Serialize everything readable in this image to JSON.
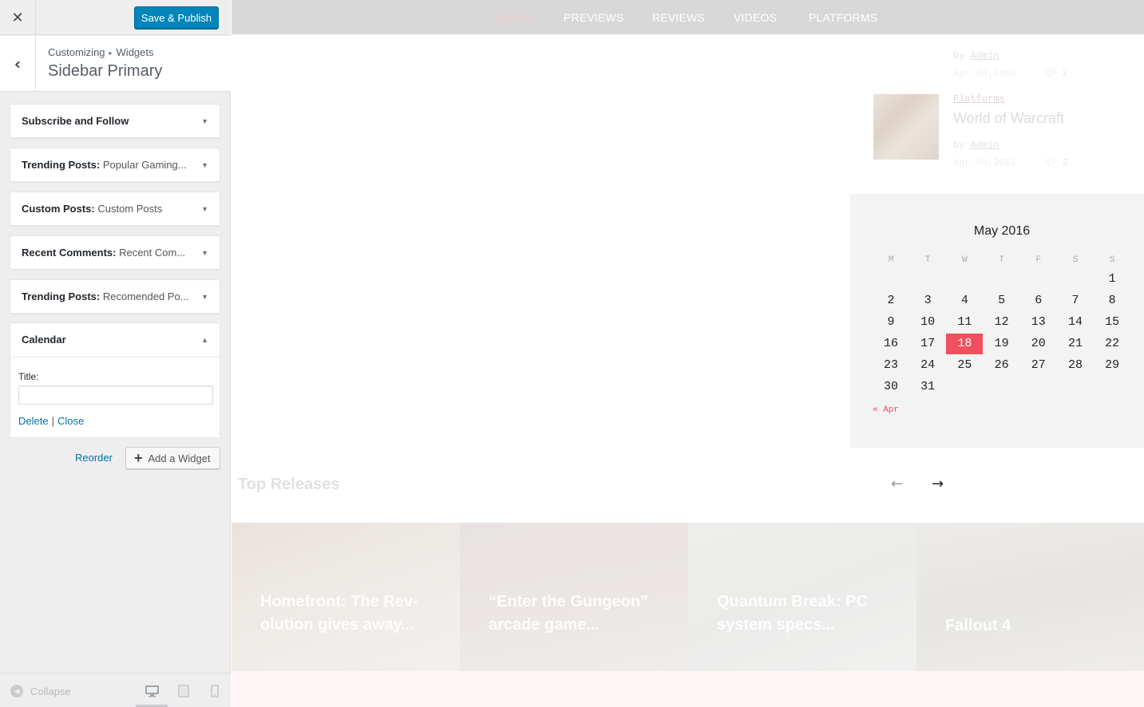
{
  "customizer": {
    "close_icon": "close-icon",
    "publish_label": "Save & Publish",
    "breadcrumb": [
      "Customizing",
      "Widgets"
    ],
    "section_title": "Sidebar Primary",
    "widgets": [
      {
        "name": "Subscribe and Follow",
        "sub": ""
      },
      {
        "name": "Trending Posts:",
        "sub": " Popular Gaming..."
      },
      {
        "name": "Custom Posts:",
        "sub": " Custom Posts"
      },
      {
        "name": "Recent Comments:",
        "sub": " Recent Com..."
      },
      {
        "name": "Trending Posts:",
        "sub": " Recomended Po..."
      }
    ],
    "calendar_widget": {
      "name": "Calendar",
      "title_label": "Title:",
      "title_value": "",
      "delete_label": "Delete",
      "separator": "|",
      "close_label": "Close"
    },
    "reorder_label": "Reorder",
    "add_widget_label": "Add a Widget",
    "collapse_label": "Collapse"
  },
  "preview": {
    "nav": [
      "NEWS",
      "PREVIEWS",
      "REVIEWS",
      "VIDEOS",
      "PLATFORMS"
    ],
    "post1": {
      "by": "by",
      "author": "Admin",
      "date": "Apr.04,2016",
      "comments": "2"
    },
    "post2": {
      "category": "Platforms",
      "title": "World of Warcraft",
      "by": "by",
      "author": "Admin",
      "date": "Apr.04,2016",
      "comments": "2"
    },
    "calendar": {
      "caption": "May 2016",
      "weekdays": [
        "M",
        "T",
        "W",
        "T",
        "F",
        "S",
        "S"
      ],
      "weeks": [
        [
          "",
          "",
          "",
          "",
          "",
          "",
          "1"
        ],
        [
          "2",
          "3",
          "4",
          "5",
          "6",
          "7",
          "8"
        ],
        [
          "9",
          "10",
          "11",
          "12",
          "13",
          "14",
          "15"
        ],
        [
          "16",
          "17",
          "18",
          "19",
          "20",
          "21",
          "22"
        ],
        [
          "23",
          "24",
          "25",
          "26",
          "27",
          "28",
          "29"
        ],
        [
          "30",
          "31",
          "",
          "",
          "",
          "",
          ""
        ]
      ],
      "today": "18",
      "prev_label": "« Apr"
    },
    "top_releases_title": "Top Releases",
    "releases": [
      "Homefront: The Rev- olution gives away...",
      "“Enter the Gungeon” arcade game...",
      "Quantum Break: PC system specs...",
      "Fallout 4"
    ]
  },
  "colors": {
    "accent": "#0085ba",
    "calendar_today": "#f0505e",
    "link": "#0073aa"
  }
}
